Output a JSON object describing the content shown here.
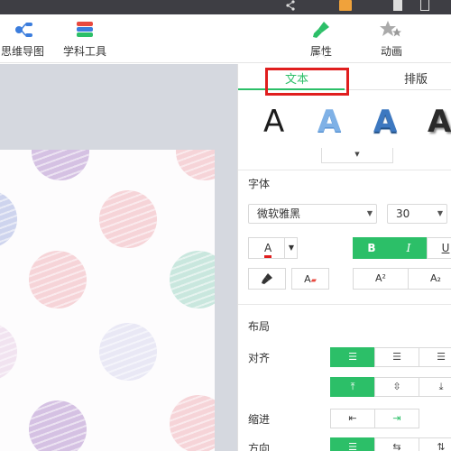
{
  "toolbar": {
    "mindmap_label": "思维导图",
    "subject_label": "学科工具",
    "attr_label": "属性",
    "anim_label": "动画"
  },
  "panel": {
    "tab_text": "文本",
    "tab_layout": "排版",
    "style_sample": "A",
    "font_section": "字体",
    "font_family": "微软雅黑",
    "font_size": "30",
    "bold_label": "B",
    "italic_label": "I",
    "underline_label": "U",
    "sup_label": "A²",
    "sub_label": "A₂",
    "layout_section": "布局",
    "align_label": "对齐",
    "indent_label": "缩进",
    "direction_label": "方向",
    "font_color": "#e01e1e",
    "accent_color": "#2cbf68"
  },
  "canvas": {
    "background_color": "#d5d8df"
  }
}
